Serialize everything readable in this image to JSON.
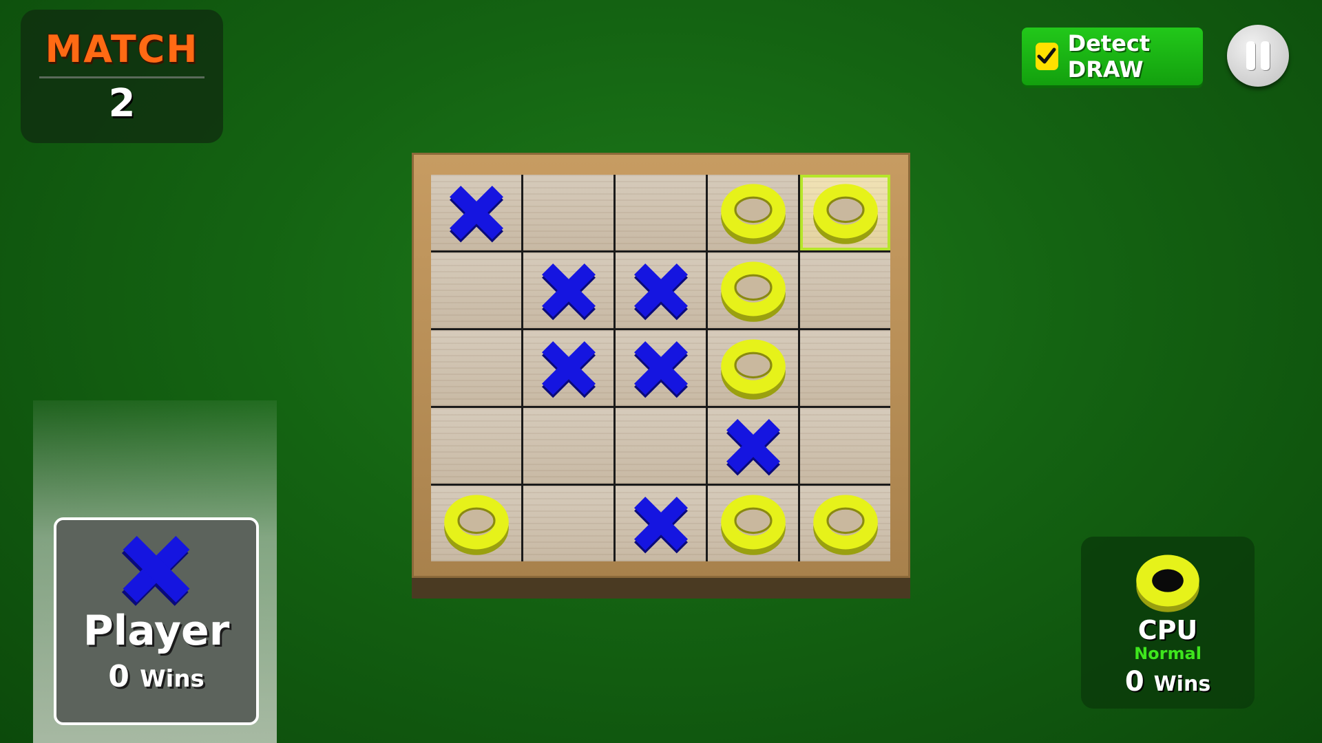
{
  "match": {
    "title": "MATCH",
    "number": "2"
  },
  "detect_draw": {
    "label": "Detect DRAW",
    "checked": true
  },
  "pause": {
    "icon": "pause-icon"
  },
  "board": {
    "rows": 5,
    "cols": 5,
    "cells": [
      [
        "X",
        "",
        "",
        "O",
        "O"
      ],
      [
        "",
        "X",
        "X",
        "O",
        ""
      ],
      [
        "",
        "X",
        "X",
        "O",
        ""
      ],
      [
        "",
        "",
        "",
        "X",
        ""
      ],
      [
        "O",
        "",
        "X",
        "O",
        "O"
      ]
    ],
    "highlighted_cell": [
      0,
      4
    ]
  },
  "player": {
    "name": "Player",
    "wins": "0",
    "wins_unit": "Wins",
    "mark": "X"
  },
  "cpu": {
    "name": "CPU",
    "level": "Normal",
    "wins": "0",
    "wins_unit": "Wins",
    "mark": "O"
  },
  "colors": {
    "x_mark": "#1515e0",
    "o_mark": "#e6f21a",
    "match_title": "#ff6a14",
    "detect_draw_bg": "#1cb815",
    "cpu_level": "#3ee61d"
  }
}
